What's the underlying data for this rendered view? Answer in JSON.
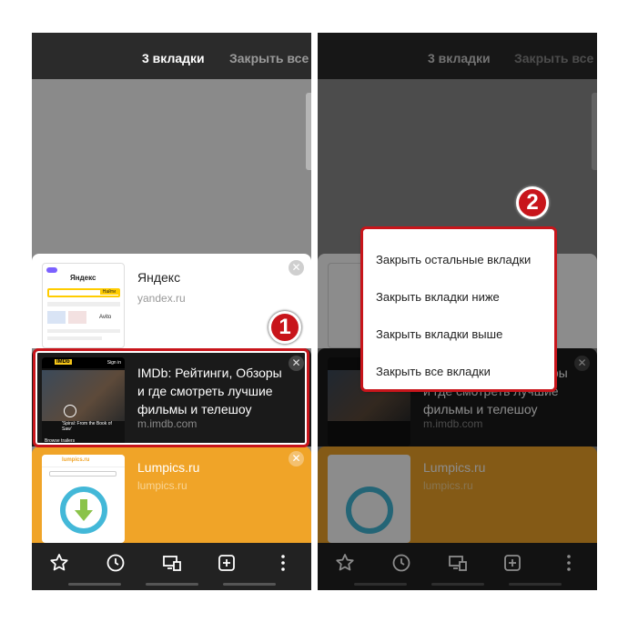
{
  "header": {
    "tab_count": "3 вкладки",
    "close_all": "Закрыть все"
  },
  "tabs": [
    {
      "title": "Яндекс",
      "url": "yandex.ru"
    },
    {
      "title": "IMDb: Рейтинги, Обзоры и где смотреть лучшие фильмы и телешоу",
      "url": "m.imdb.com"
    },
    {
      "title": "Lumpics.ru",
      "url": "lumpics.ru"
    }
  ],
  "thumbnails": {
    "yandex": {
      "brand": "Яндекс",
      "find": "Найти",
      "avito": "Avito"
    },
    "imdb": {
      "logo": "IMDb",
      "sign_in": "Sign in",
      "caption": "'Spiral: From the Book of Saw'",
      "browse": "Browse trailers"
    },
    "lumpics": {
      "brand": "lumpics.ru"
    }
  },
  "context_menu": {
    "items": [
      "Закрыть остальные вкладки",
      "Закрыть вкладки ниже",
      "Закрыть вкладки выше",
      "Закрыть все вкладки"
    ]
  },
  "step_badges": [
    "1",
    "2"
  ],
  "bottom_bar": {
    "icons": [
      "star-icon",
      "history-icon",
      "devices-icon",
      "new-tab-icon",
      "more-icon"
    ]
  },
  "colors": {
    "accent_red": "#c8151b",
    "lumpics_orange": "#f0a428",
    "imdb_yellow": "#f5c518"
  }
}
